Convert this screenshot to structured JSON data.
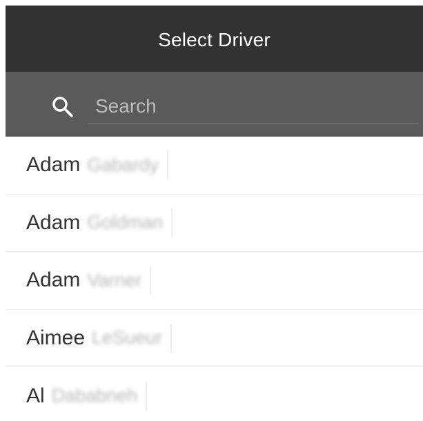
{
  "header": {
    "title": "Select Driver"
  },
  "search": {
    "placeholder": "Search",
    "value": ""
  },
  "icons": {
    "search": "search-icon"
  },
  "drivers": [
    {
      "first_name": "Adam",
      "last_name": "Gabardy"
    },
    {
      "first_name": "Adam",
      "last_name": "Goldman"
    },
    {
      "first_name": "Adam",
      "last_name": "Varner"
    },
    {
      "first_name": "Aimee",
      "last_name": "LeSueur"
    },
    {
      "first_name": "Al",
      "last_name": "Dababneh"
    }
  ],
  "colors": {
    "header_bg": "#323232",
    "searchbar_bg": "#5a5a5a",
    "list_bg": "#ffffff"
  }
}
